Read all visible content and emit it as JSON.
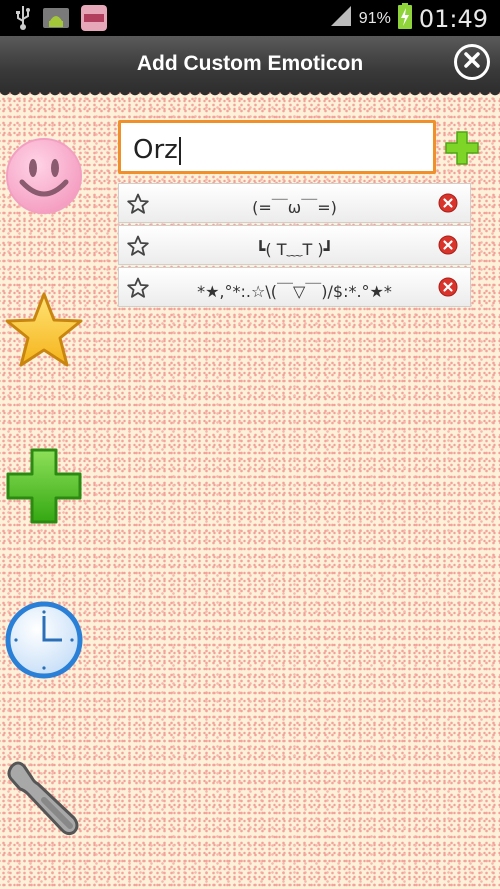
{
  "status_bar": {
    "battery_percent": "91%",
    "time": "01:49",
    "icons": [
      "usb-icon",
      "android-debug-icon",
      "app-notification-icon",
      "signal-icon",
      "battery-charging-icon"
    ]
  },
  "header": {
    "title": "Add Custom Emoticon",
    "close_icon": "close-icon"
  },
  "input": {
    "value": "Orz"
  },
  "emoticons": [
    {
      "text": "(=￣ω￣=)"
    },
    {
      "text": "┗( T﹏T )┛"
    },
    {
      "text": "*★,°*:.☆\\(￣▽￣)/$:*.°★*"
    }
  ],
  "sidebar": {
    "items": [
      "smiley-icon",
      "star-icon",
      "plus-icon",
      "clock-icon",
      "wrench-icon"
    ]
  },
  "colors": {
    "accent_orange": "#f0902a",
    "add_green": "#6ccf1e",
    "delete_red": "#d9342b",
    "clock_blue": "#2a7fd6"
  }
}
